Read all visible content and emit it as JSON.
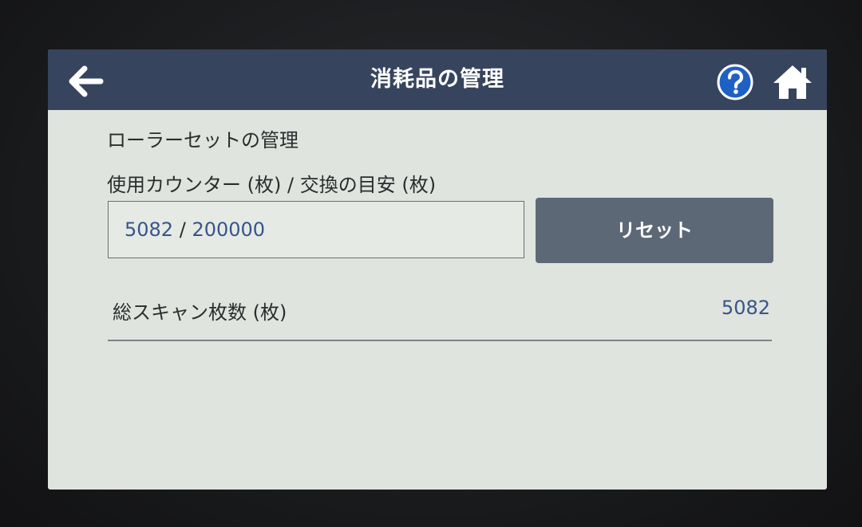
{
  "header": {
    "title": "消耗品の管理",
    "back_icon": "arrow-left-icon",
    "help_icon": "question-mark-icon",
    "home_icon": "home-icon"
  },
  "roller": {
    "section_title": "ローラーセットの管理",
    "counter_label": "使用カウンター (枚) / 交換の目安 (枚)",
    "counter_used": "5082",
    "counter_separator": "/",
    "counter_limit": "200000",
    "reset_label": "リセット"
  },
  "scan_total": {
    "label": "総スキャン枚数 (枚)",
    "value": "5082"
  },
  "colors": {
    "header_bg": "#37445e",
    "screen_bg": "#dfe4de",
    "value_text": "#37558a",
    "reset_button_bg": "#5d6877",
    "help_icon_bg": "#1e61c4"
  }
}
